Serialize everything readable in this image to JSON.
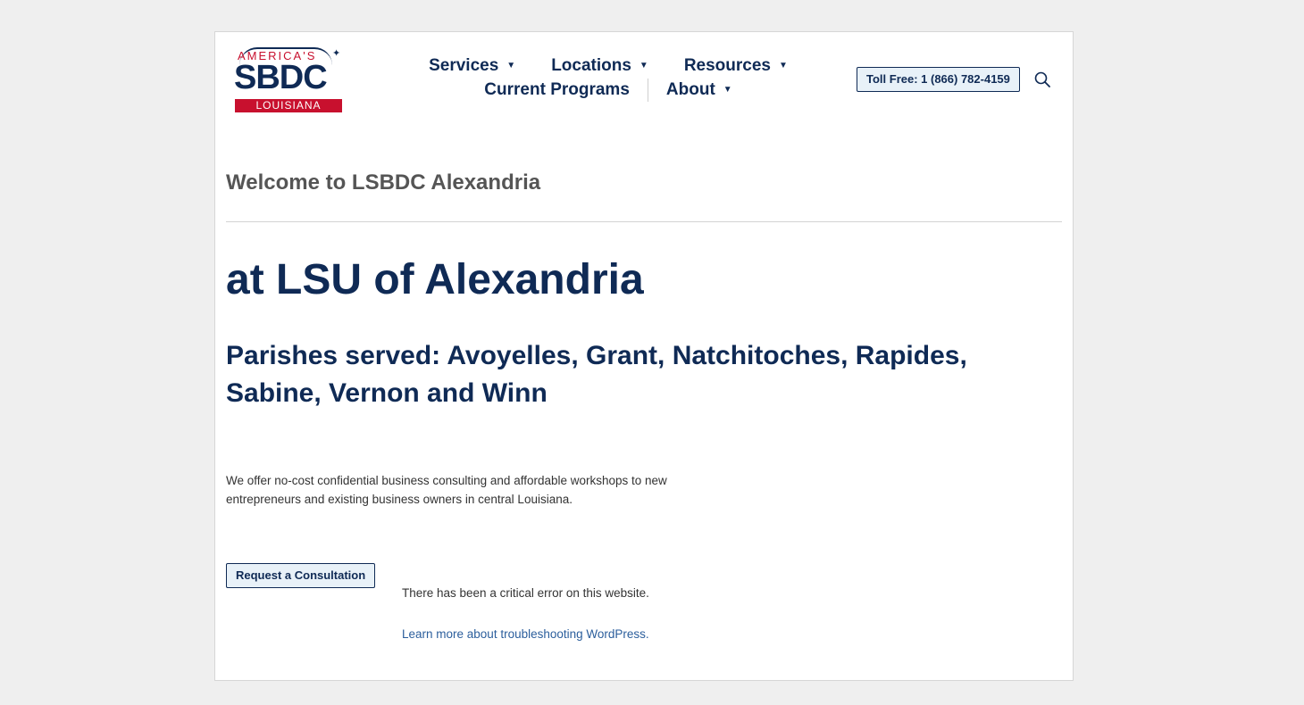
{
  "logo": {
    "top_text": "AMERICA'S",
    "main_text": "SBDC",
    "bottom_text": "LOUISIANA"
  },
  "nav": {
    "row1": [
      {
        "label": "Services",
        "has_dropdown": true
      },
      {
        "label": "Locations",
        "has_dropdown": true
      },
      {
        "label": "Resources",
        "has_dropdown": true
      }
    ],
    "row2": [
      {
        "label": "Current Programs",
        "has_dropdown": false
      },
      {
        "label": "About",
        "has_dropdown": true
      }
    ]
  },
  "toll_free": "Toll Free: 1 (866) 782-4159",
  "search_icon": "search-icon",
  "page": {
    "welcome": "Welcome to LSBDC Alexandria",
    "heading": "at LSU of Alexandria",
    "subheading": "Parishes served: Avoyelles, Grant, Natchitoches, Rapides, Sabine, Vernon and Winn",
    "description": "We offer no-cost confidential business consulting and affordable workshops to new entrepreneurs and existing business owners in central Louisiana.",
    "consult_button": "Request a Consultation",
    "error_text": "There has been a critical error on this website.",
    "learn_link": "Learn more about troubleshooting WordPress."
  },
  "colors": {
    "navy": "#0f2a55",
    "red": "#c8102e",
    "button_bg": "#e8f1f8",
    "link": "#2b5e9c"
  }
}
